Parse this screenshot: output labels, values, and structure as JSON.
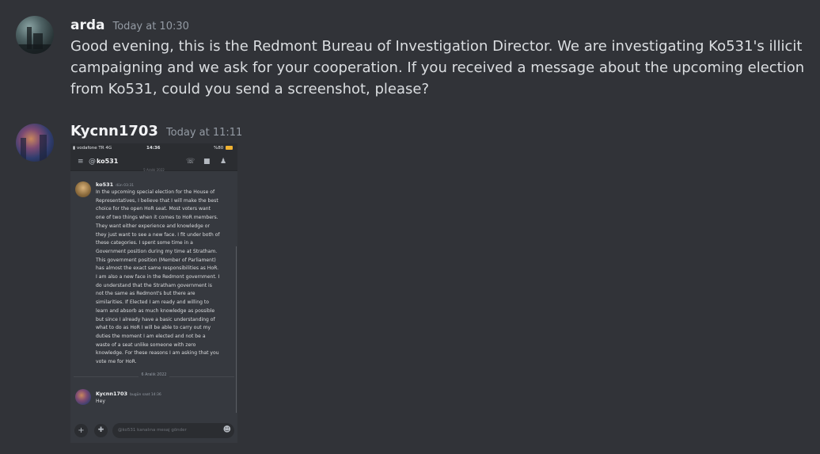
{
  "messages": [
    {
      "author": "arda",
      "timestamp": "Today at 10:30",
      "text": "Good evening, this is the Redmont Bureau of Investigation Director. We are investigating Ko531's illicit campaigning and we ask for your cooperation. If you received a message about the upcoming election from Ko531, could you send a screenshot, please?"
    },
    {
      "author": "Kycnn1703",
      "timestamp": "Today at 11:11",
      "attachment": {
        "status_bar": {
          "carrier": "vodafone TR  4G",
          "time": "14:36",
          "battery": "%80"
        },
        "channel": "ko531",
        "cut_off_date": "5 Aralık 2022",
        "dm_messages": [
          {
            "author": "ko531",
            "time": "dün 03:31",
            "lines": [
              "In the upcoming special election for the House of",
              "Representatives, I believe that I will make the best",
              "choice for the open HoR seat. Most voters want",
              "one of two things when it comes to HoR members.",
              "They want either experience and knowledge or",
              "they just want to see a new face. I fit under both of",
              "these categories. I spent some time in a",
              "Government position during my time at Stratham.",
              "This government position (Member of Parliament)",
              "has almost the exact same responsibilities as HoR.",
              "I am also a new face in the Redmont government. I",
              "do understand that the Stratham government is",
              "not the same as Redmont's but there are",
              "similarities. If Elected I am ready and willing to",
              "learn and absorb as much knowledge as possible",
              "but since I already have a basic understanding of",
              "what to do as HoR I will be able to carry out my",
              "duties the moment I am elected and not be a",
              "waste of a seat unlike someone with zero",
              "knowledge. For these reasons I am asking that you",
              "vote me for HoR."
            ]
          },
          {
            "author": "Kycnn1703",
            "time": "bugün saat 14:36",
            "lines": [
              "Hey"
            ]
          }
        ],
        "date_divider": "6 Aralık 2022",
        "input_placeholder": "@ko531 kanalına mesaj gönder"
      }
    }
  ]
}
